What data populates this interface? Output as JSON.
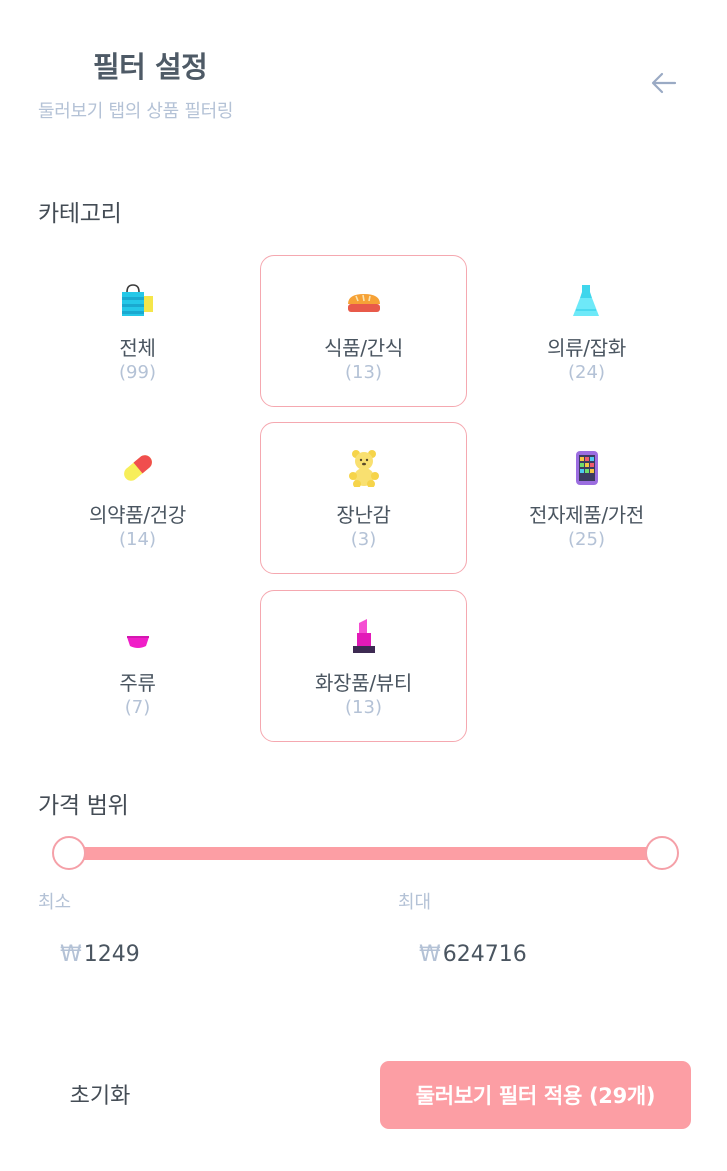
{
  "header": {
    "title": "필터 설정",
    "subtitle": "둘러보기 탭의 상품 필터링",
    "back_icon": "arrow-left-icon"
  },
  "category_section": {
    "title": "카테고리",
    "items": [
      {
        "label": "전체",
        "count": "(99)",
        "icon": "shopping-bag-icon",
        "selected": false
      },
      {
        "label": "식품/간식",
        "count": "(13)",
        "icon": "bread-icon",
        "selected": true
      },
      {
        "label": "의류/잡화",
        "count": "(24)",
        "icon": "dress-icon",
        "selected": false
      },
      {
        "label": "의약품/건강",
        "count": "(14)",
        "icon": "pill-icon",
        "selected": false
      },
      {
        "label": "장난감",
        "count": "(3)",
        "icon": "teddy-bear-icon",
        "selected": true
      },
      {
        "label": "전자제품/가전",
        "count": "(25)",
        "icon": "smartphone-icon",
        "selected": false
      },
      {
        "label": "주류",
        "count": "(7)",
        "icon": "cocktail-glass-icon",
        "selected": false
      },
      {
        "label": "화장품/뷰티",
        "count": "(13)",
        "icon": "lipstick-icon",
        "selected": true
      }
    ]
  },
  "price_section": {
    "title": "가격 범위",
    "min_label": "최소",
    "max_label": "최대",
    "currency_symbol": "₩",
    "min_value": "1249",
    "max_value": "624716"
  },
  "footer": {
    "reset_label": "초기화",
    "apply_label": "둘러보기 필터 적용 (29개)"
  },
  "colors": {
    "accent": "#fc9ea4",
    "selected_border": "#f5a8b0",
    "muted_text": "#b4c2d6",
    "primary_text": "#4a5560"
  }
}
